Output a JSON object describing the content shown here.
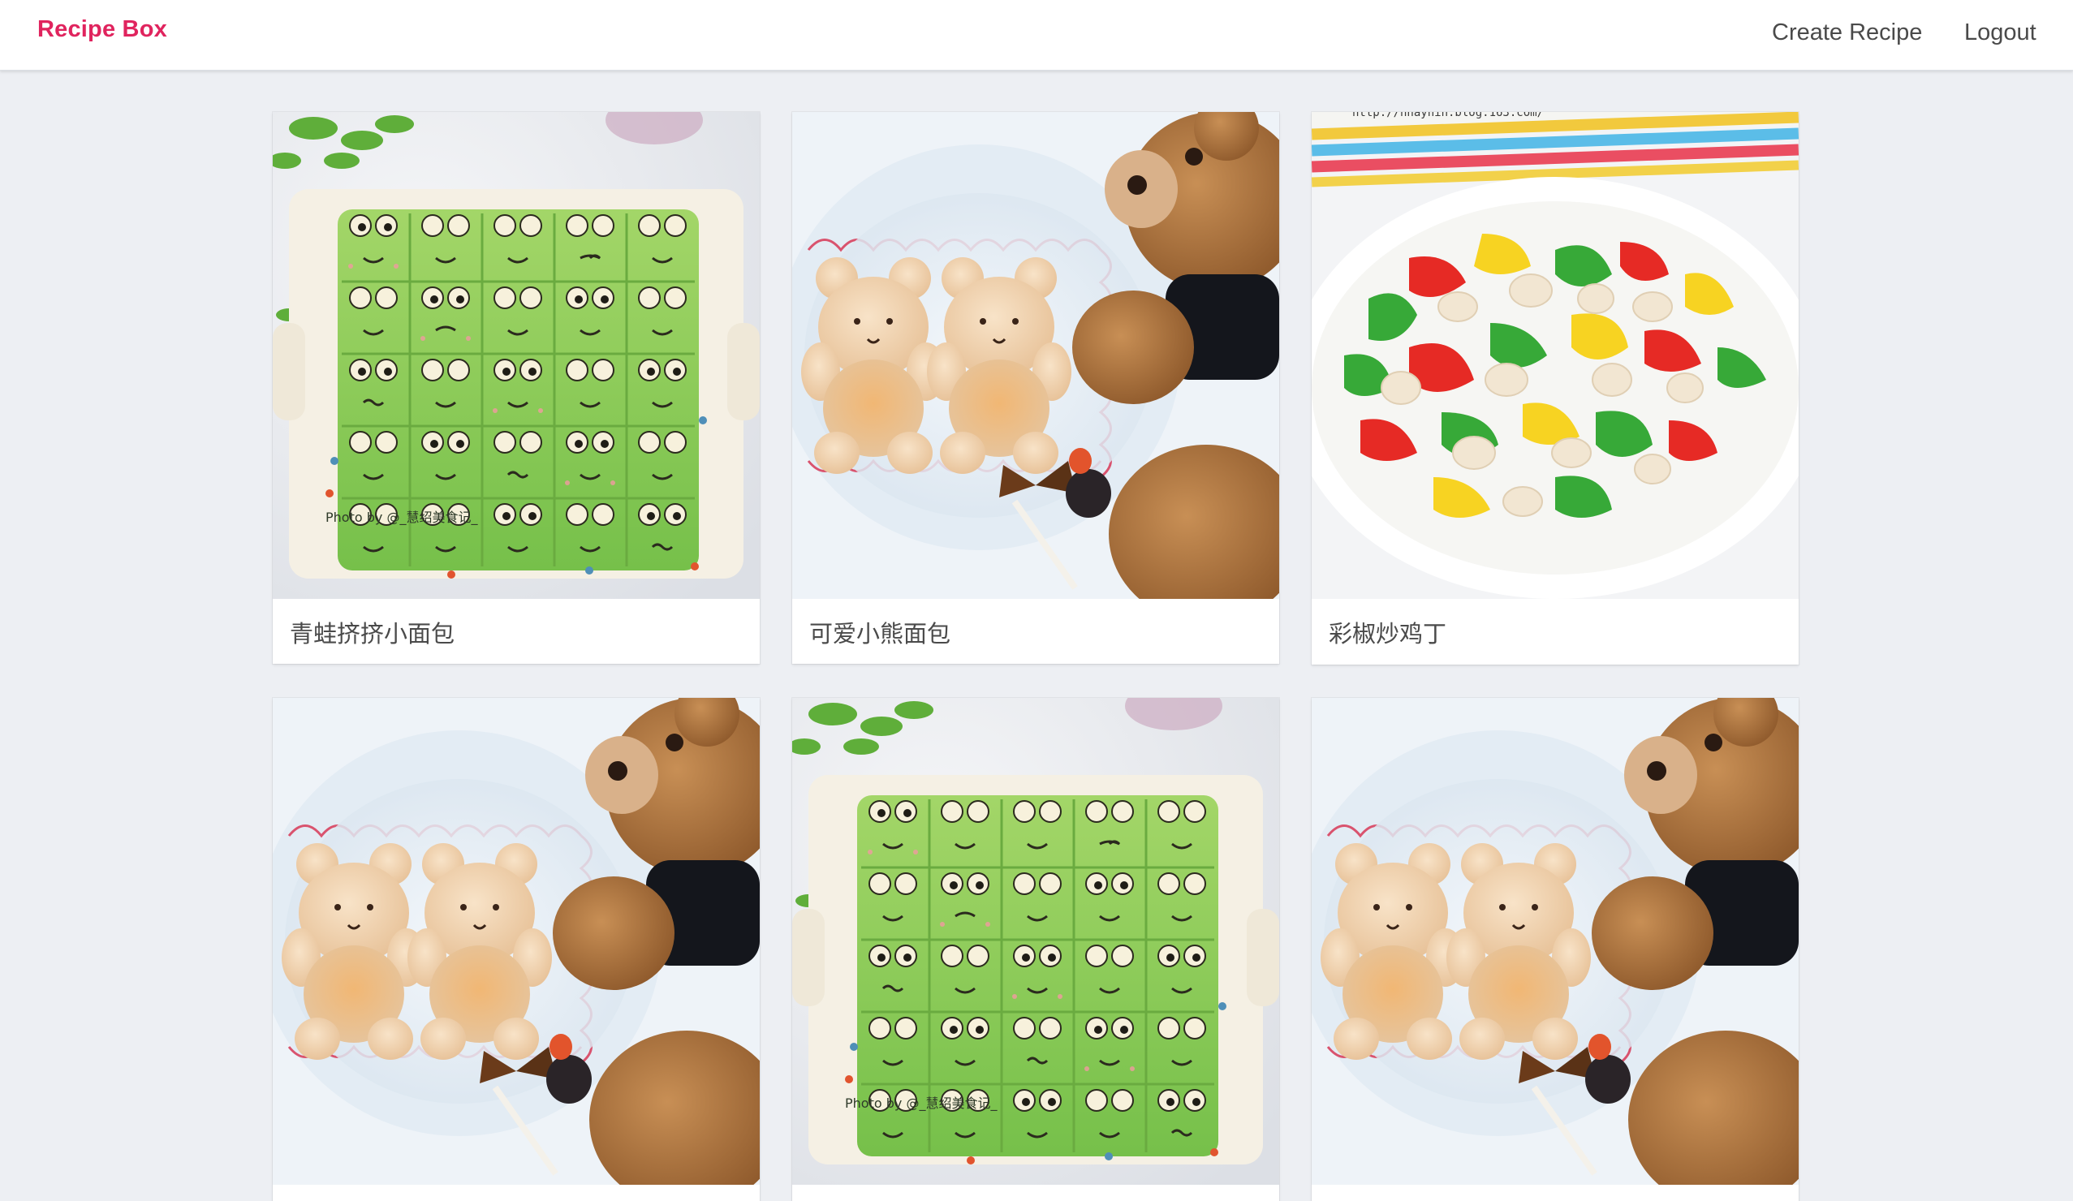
{
  "navbar": {
    "brand": "Recipe Box",
    "links": {
      "create": "Create Recipe",
      "logout": "Logout"
    }
  },
  "colors": {
    "brand": "#e0245e",
    "background": "#edeff3",
    "card": "#ffffff",
    "text": "#4a4a4a"
  },
  "recipes": [
    {
      "title": "青蛙挤挤小面包",
      "image": "frog-bread"
    },
    {
      "title": "可爱小熊面包",
      "image": "bear-bread"
    },
    {
      "title": "彩椒炒鸡丁",
      "image": "pepper-chicken"
    },
    {
      "title": "",
      "image": "bear-bread"
    },
    {
      "title": "",
      "image": "frog-bread"
    },
    {
      "title": "",
      "image": "bear-bread"
    }
  ],
  "image_watermarks": {
    "frog": "Photo by @_慧绍美食记_"
  }
}
